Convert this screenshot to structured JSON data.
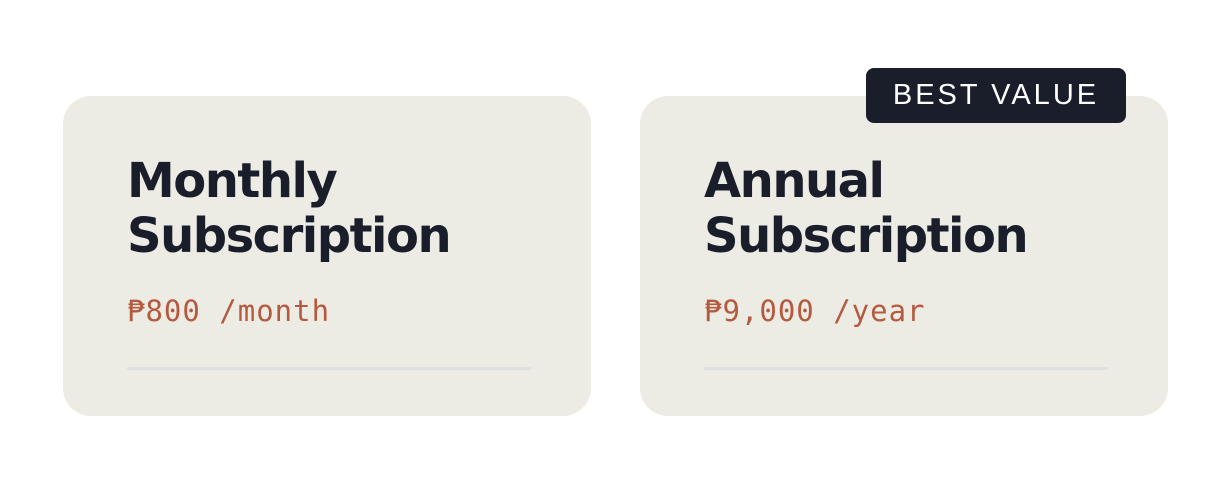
{
  "plans": [
    {
      "title": "Monthly\nSubscription",
      "price": "₱800 /month"
    },
    {
      "title": "Annual\nSubscription",
      "price": "₱9,000 /year",
      "badge": "BEST VALUE"
    }
  ],
  "colors": {
    "card_background": "#ecebe4",
    "title_text": "#1a1e2a",
    "price_text": "#b55a3f",
    "badge_background": "#1a1e2a",
    "badge_text": "#ffffff",
    "divider": "#dde1e2"
  }
}
